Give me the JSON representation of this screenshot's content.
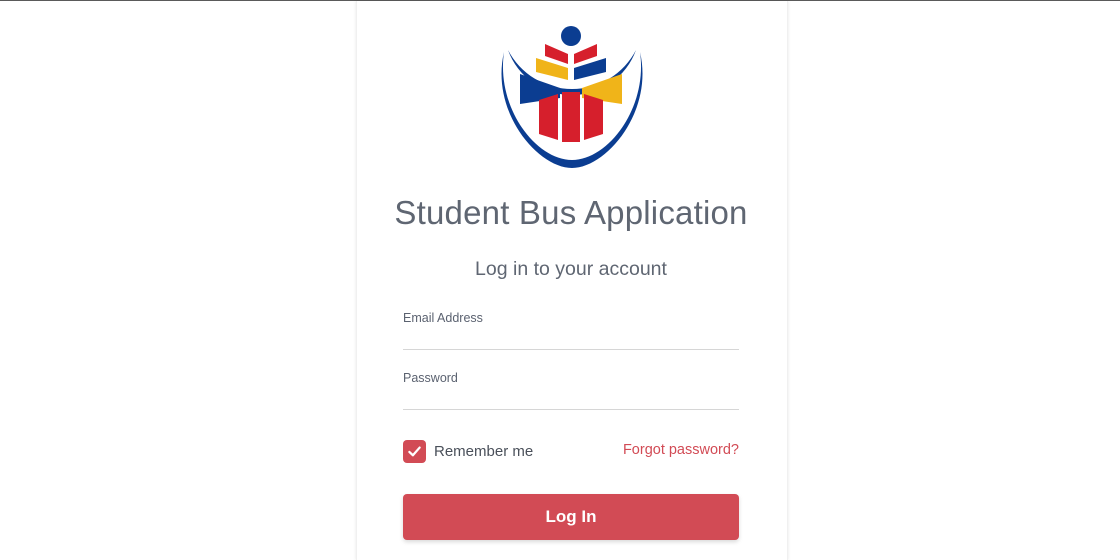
{
  "app": {
    "title": "Student Bus Application",
    "subtitle": "Log in to your account"
  },
  "form": {
    "email_label": "Email Address",
    "email_value": "",
    "password_label": "Password",
    "password_value": "",
    "remember_label": "Remember me",
    "remember_checked": true,
    "forgot_label": "Forgot password?",
    "submit_label": "Log In"
  },
  "theme": {
    "accent": "#d24b55",
    "text": "#5f6672",
    "logo_blue": "#0b3d91",
    "logo_red": "#d61f2c",
    "logo_yellow": "#f0b419"
  },
  "icons": {
    "logo": "school-emblem-logo",
    "checkbox": "check-icon"
  }
}
